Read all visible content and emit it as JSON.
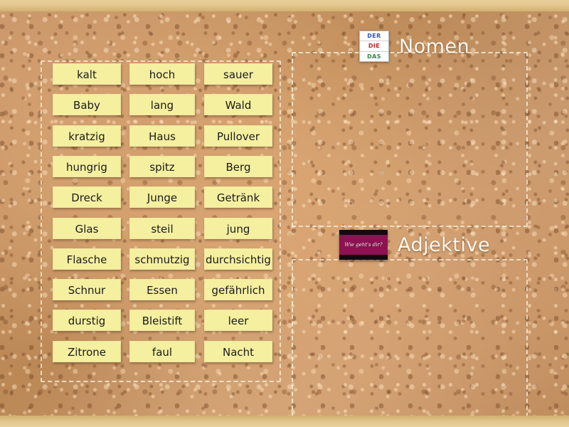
{
  "board": {
    "surface_color": "#c08e5e",
    "frame_color": "#e3c78f"
  },
  "word_bank": {
    "tile_color": "#f5efa0",
    "columns": 3,
    "rows": 11,
    "tiles": [
      {
        "label": "kalt",
        "col": 0,
        "row": 0
      },
      {
        "label": "hoch",
        "col": 1,
        "row": 0
      },
      {
        "label": "sauer",
        "col": 2,
        "row": 0
      },
      {
        "label": "Baby",
        "col": 0,
        "row": 1
      },
      {
        "label": "lang",
        "col": 1,
        "row": 1
      },
      {
        "label": "Wald",
        "col": 2,
        "row": 1
      },
      {
        "label": "kratzig",
        "col": 0,
        "row": 2
      },
      {
        "label": "Haus",
        "col": 1,
        "row": 2
      },
      {
        "label": "Pullover",
        "col": 2,
        "row": 2
      },
      {
        "label": "hungrig",
        "col": 0,
        "row": 3
      },
      {
        "label": "spitz",
        "col": 1,
        "row": 3
      },
      {
        "label": "Berg",
        "col": 2,
        "row": 3
      },
      {
        "label": "Dreck",
        "col": 0,
        "row": 4
      },
      {
        "label": "Junge",
        "col": 1,
        "row": 4
      },
      {
        "label": "Getränk",
        "col": 2,
        "row": 4
      },
      {
        "label": "Glas",
        "col": 0,
        "row": 5
      },
      {
        "label": "steil",
        "col": 1,
        "row": 5
      },
      {
        "label": "jung",
        "col": 2,
        "row": 5
      },
      {
        "label": "Flasche",
        "col": 0,
        "row": 6
      },
      {
        "label": "schmutzig",
        "col": 1,
        "row": 6
      },
      {
        "label": "durchsichtig",
        "col": 2,
        "row": 6
      },
      {
        "label": "Schnur",
        "col": 0,
        "row": 7
      },
      {
        "label": "Essen",
        "col": 1,
        "row": 7
      },
      {
        "label": "gefährlich",
        "col": 2,
        "row": 7
      },
      {
        "label": "durstig",
        "col": 0,
        "row": 8
      },
      {
        "label": "Bleistift",
        "col": 1,
        "row": 8
      },
      {
        "label": "leer",
        "col": 2,
        "row": 8
      },
      {
        "label": "Zitrone",
        "col": 0,
        "row": 9
      },
      {
        "label": "faul",
        "col": 1,
        "row": 9
      },
      {
        "label": "Nacht",
        "col": 2,
        "row": 9
      }
    ]
  },
  "categories": [
    {
      "id": "nomen",
      "label": "Nomen",
      "icon": "der-die-das-card",
      "icon_rows": [
        {
          "text": "DER",
          "color": "#3355bb"
        },
        {
          "text": "DIE",
          "color": "#cc2222"
        },
        {
          "text": "DAS",
          "color": "#2f8a3f"
        }
      ]
    },
    {
      "id": "adjektive",
      "label": "Adjektive",
      "icon": "banner-thumbnail",
      "icon_text": "Wie geht's dir?",
      "icon_color": "#8e1152"
    }
  ]
}
